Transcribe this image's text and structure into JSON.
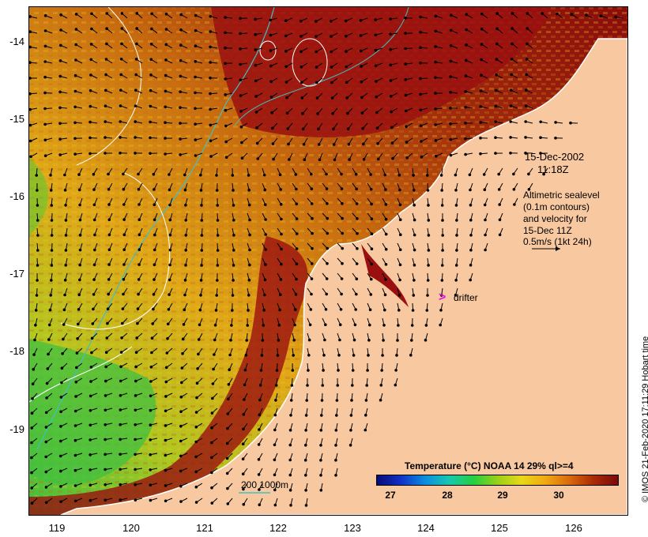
{
  "map": {
    "title_date": "15-Dec-2002",
    "title_time": "11:18Z",
    "altimetry_note": [
      "Altimetric sealevel",
      "(0.1m contours)",
      "and velocity for",
      "15-Dec 11Z",
      "0.5m/s (1kt 24h)"
    ],
    "drifter_symbol": ">",
    "drifter_label": "drifter",
    "bathymetry_label": "200  1000m",
    "legend_title": "Temperature (°C) NOAA 14 29% ql>=4",
    "colorbar_ticks": [
      "27",
      "28",
      "29",
      "30"
    ],
    "credit": "© IMOS 21-Feb-2020 17:11:29 Hobart time",
    "y_axis_ticks": [
      "-14",
      "-15",
      "-16",
      "-17",
      "-18",
      "-19"
    ],
    "x_axis_ticks": [
      "119",
      "120",
      "121",
      "122",
      "123",
      "124",
      "125",
      "126"
    ],
    "colors": {
      "land": "#f8c8a0",
      "warm_water": "#9a1010",
      "mid_water": "#d89018",
      "cool_water": "#40c040",
      "contour_white": "#ffffff",
      "bathymetry_cyan": "#40c0c0",
      "drifter": "#e018e0"
    }
  }
}
